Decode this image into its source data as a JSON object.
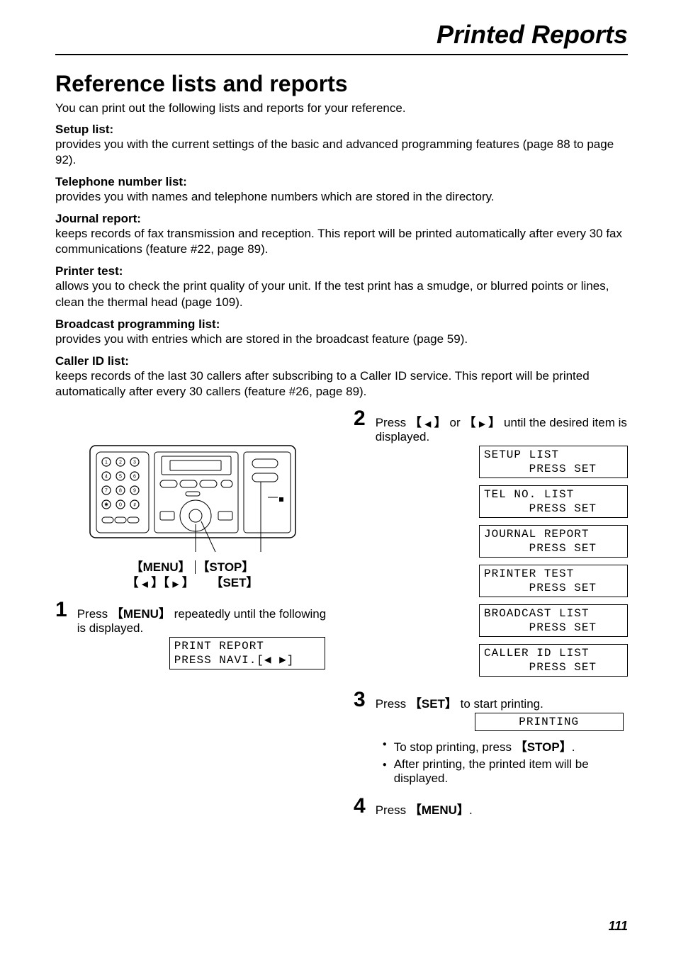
{
  "top_title": "Printed Reports",
  "heading": "Reference lists and reports",
  "intro": "You can print out the following lists and reports for your reference.",
  "sections": [
    {
      "h": "Setup list:",
      "t": "provides you with the current settings of the basic and advanced programming features (page 88 to page 92)."
    },
    {
      "h": "Telephone number list:",
      "t": "provides you with names and telephone numbers which are stored in the directory."
    },
    {
      "h": "Journal report:",
      "t": "keeps records of fax transmission and reception. This report will be printed automatically after every 30 fax communications (feature #22, page 89)."
    },
    {
      "h": "Printer test:",
      "t": "allows you to check the print quality of your unit. If the test print has a smudge, or blurred points or lines, clean the thermal head (page 109)."
    },
    {
      "h": "Broadcast programming list:",
      "t": "provides you with entries which are stored in the broadcast feature (page 59)."
    },
    {
      "h": "Caller ID list:",
      "t": "keeps records of the last 30 callers after subscribing to a Caller ID service. This report will be printed automatically after every 30 callers (feature #26, page 89)."
    }
  ],
  "illus": {
    "labels_line1_a": "MENU",
    "labels_line1_b": "STOP",
    "labels_line2_b": "SET"
  },
  "step1": {
    "num": "1",
    "text_a": "Press ",
    "key": "MENU",
    "text_b": " repeatedly until the following is displayed.",
    "lcd": "PRINT REPORT\nPRESS NAVI.[◀ ▶]"
  },
  "step2": {
    "num": "2",
    "text_a": "Press ",
    "text_b": " or ",
    "text_c": " until the desired item is displayed.",
    "lcds": [
      "SETUP LIST\n      PRESS SET",
      "TEL NO. LIST\n      PRESS SET",
      "JOURNAL REPORT\n      PRESS SET",
      "PRINTER TEST\n      PRESS SET",
      "BROADCAST LIST\n      PRESS SET",
      "CALLER ID LIST\n      PRESS SET"
    ]
  },
  "step3": {
    "num": "3",
    "text_a": "Press ",
    "key": "SET",
    "text_b": " to start printing.",
    "lcd": "PRINTING",
    "bullets_a_pre": "To stop printing, press ",
    "bullets_a_key": "STOP",
    "bullets_a_post": ".",
    "bullets_b": "After printing, the printed item will be displayed."
  },
  "step4": {
    "num": "4",
    "text_a": "Press ",
    "key": "MENU",
    "text_b": "."
  },
  "page_number": "111"
}
